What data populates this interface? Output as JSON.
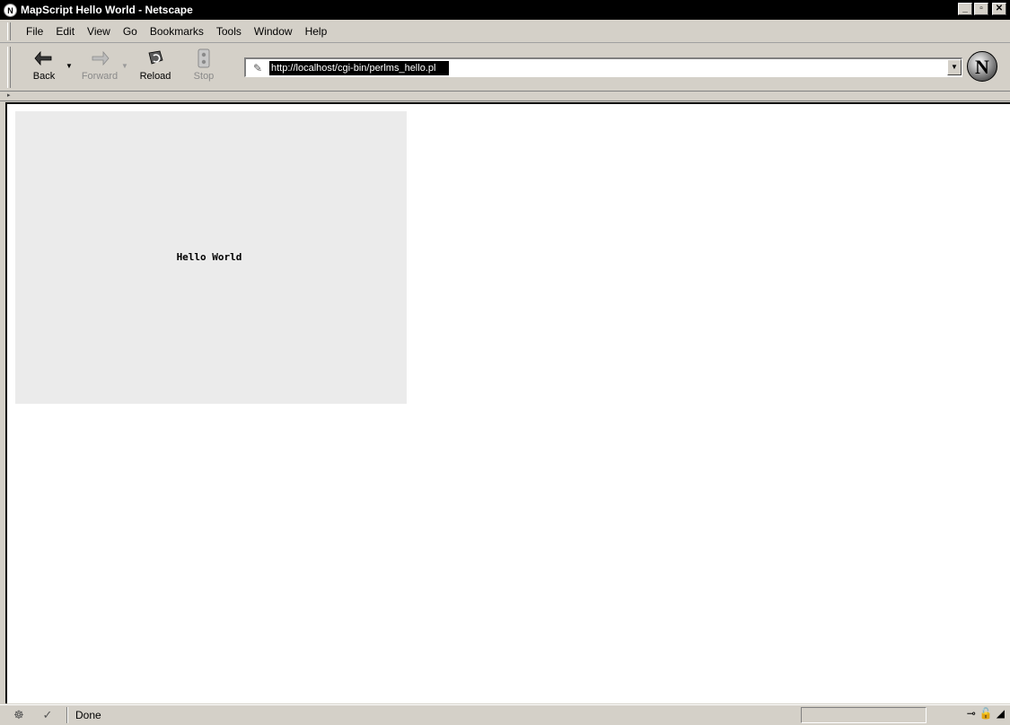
{
  "window": {
    "title": "MapScript Hello World - Netscape",
    "app_icon": "netscape-icon",
    "controls": [
      "minimize",
      "maximize",
      "close"
    ]
  },
  "menu": {
    "items": [
      "File",
      "Edit",
      "View",
      "Go",
      "Bookmarks",
      "Tools",
      "Window",
      "Help"
    ]
  },
  "toolbar": {
    "back_label": "Back",
    "forward_label": "Forward",
    "reload_label": "Reload",
    "stop_label": "Stop"
  },
  "address": {
    "url": "http://localhost/cgi-bin/perlms_hello.pl"
  },
  "content": {
    "map_text": "Hello World",
    "map_bg": "#ebebeb"
  },
  "status": {
    "text": "Done"
  },
  "colors": {
    "titlebar_bg": "#000000",
    "chrome_bg": "#d4d0c8",
    "content_bg": "#ffffff"
  }
}
